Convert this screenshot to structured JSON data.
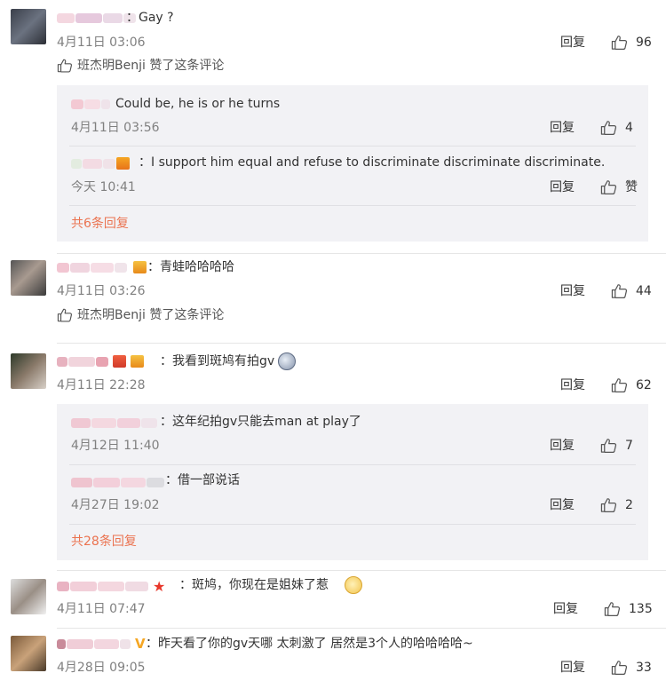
{
  "icons": {
    "like": "thumb-up-icon",
    "liked_by": "thumb-up-outline-icon"
  },
  "colors": {
    "link": "#eb7350",
    "time": "#808080",
    "sub_bg": "#f2f2f5"
  },
  "comments": [
    {
      "text": "：Gay ?",
      "time": "4月11日 03:06",
      "reply": "回复",
      "likes": "96",
      "liked_by": "班杰明Benji 赞了这条评论",
      "replies": [
        {
          "text": "Could be, he is or he turns",
          "time": "4月11日 03:56",
          "reply": "回复",
          "likes": "4"
        },
        {
          "text": "：I support him equal and refuse to discriminate discriminate discriminate.",
          "time": "今天 10:41",
          "reply": "回复",
          "likes": "赞"
        }
      ],
      "more": "共6条回复"
    },
    {
      "text": "：青蛙哈哈哈哈",
      "time": "4月11日 03:26",
      "reply": "回复",
      "likes": "44",
      "liked_by": "班杰明Benji 赞了这条评论"
    },
    {
      "text": "：我看到斑鸠有拍gv",
      "time": "4月11日 22:28",
      "reply": "回复",
      "likes": "62",
      "replies": [
        {
          "text": "：这年纪拍gv只能去man at play了",
          "time": "4月12日 11:40",
          "reply": "回复",
          "likes": "7"
        },
        {
          "text": "：借一部说话",
          "time": "4月27日 19:02",
          "reply": "回复",
          "likes": "2"
        }
      ],
      "more": "共28条回复"
    },
    {
      "text": "：斑鸠，你现在是姐妹了惹",
      "time": "4月11日 07:47",
      "reply": "回复",
      "likes": "135"
    },
    {
      "text": "：昨天看了你的gv天哪 太刺激了 居然是3个人的哈哈哈哈~",
      "time": "4月28日 09:05",
      "reply": "回复",
      "likes": "33"
    }
  ]
}
